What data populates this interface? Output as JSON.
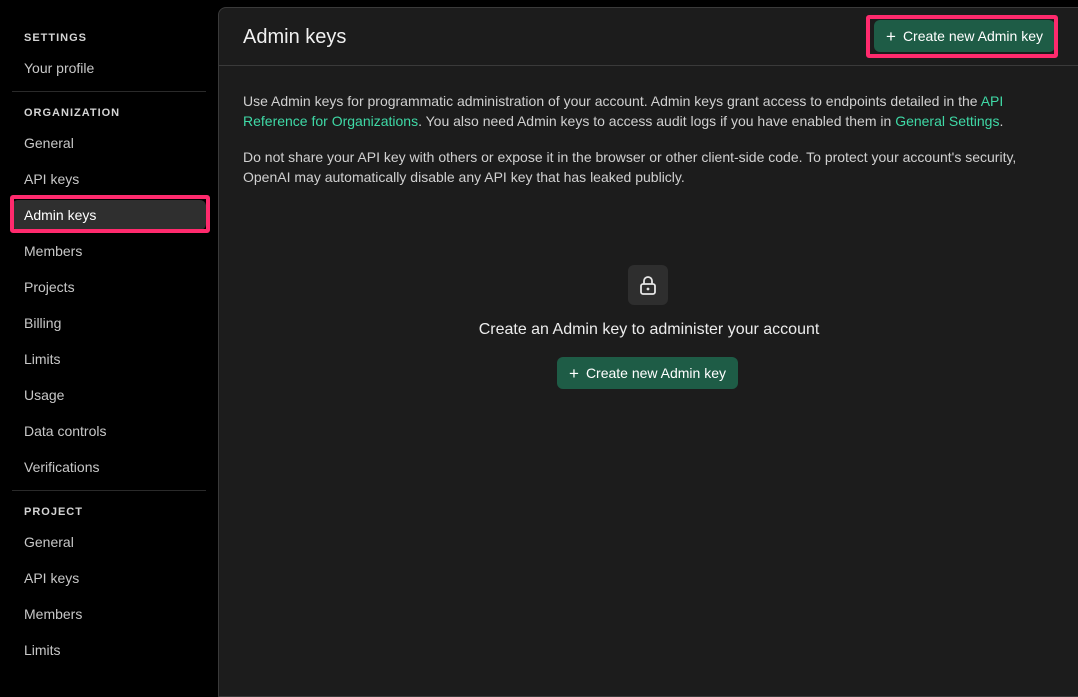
{
  "sidebar": {
    "settings_label": "SETTINGS",
    "your_profile": "Your profile",
    "organization_label": "ORGANIZATION",
    "org_items": [
      "General",
      "API keys",
      "Admin keys",
      "Members",
      "Projects",
      "Billing",
      "Limits",
      "Usage",
      "Data controls",
      "Verifications"
    ],
    "project_label": "PROJECT",
    "project_items": [
      "General",
      "API keys",
      "Members",
      "Limits"
    ]
  },
  "header": {
    "title": "Admin keys",
    "create_button": "Create new Admin key"
  },
  "description": {
    "p1_text_a": "Use Admin keys for programmatic administration of your account. Admin keys grant access to endpoints detailed in the ",
    "p1_link_a": "API Reference for Organizations",
    "p1_text_b": ". You also need Admin keys to access audit logs if you have enabled them in ",
    "p1_link_b": "General Settings",
    "p1_text_c": ".",
    "p2": "Do not share your API key with others or expose it in the browser or other client-side code. To protect your account's security, OpenAI may automatically disable any API key that has leaked publicly."
  },
  "empty_state": {
    "icon": "lock-icon",
    "title": "Create an Admin key to administer your account",
    "button": "Create new Admin key"
  },
  "colors": {
    "accent_button": "#1e5c46",
    "link": "#3fd9a6",
    "highlight": "#ff2a6d"
  }
}
